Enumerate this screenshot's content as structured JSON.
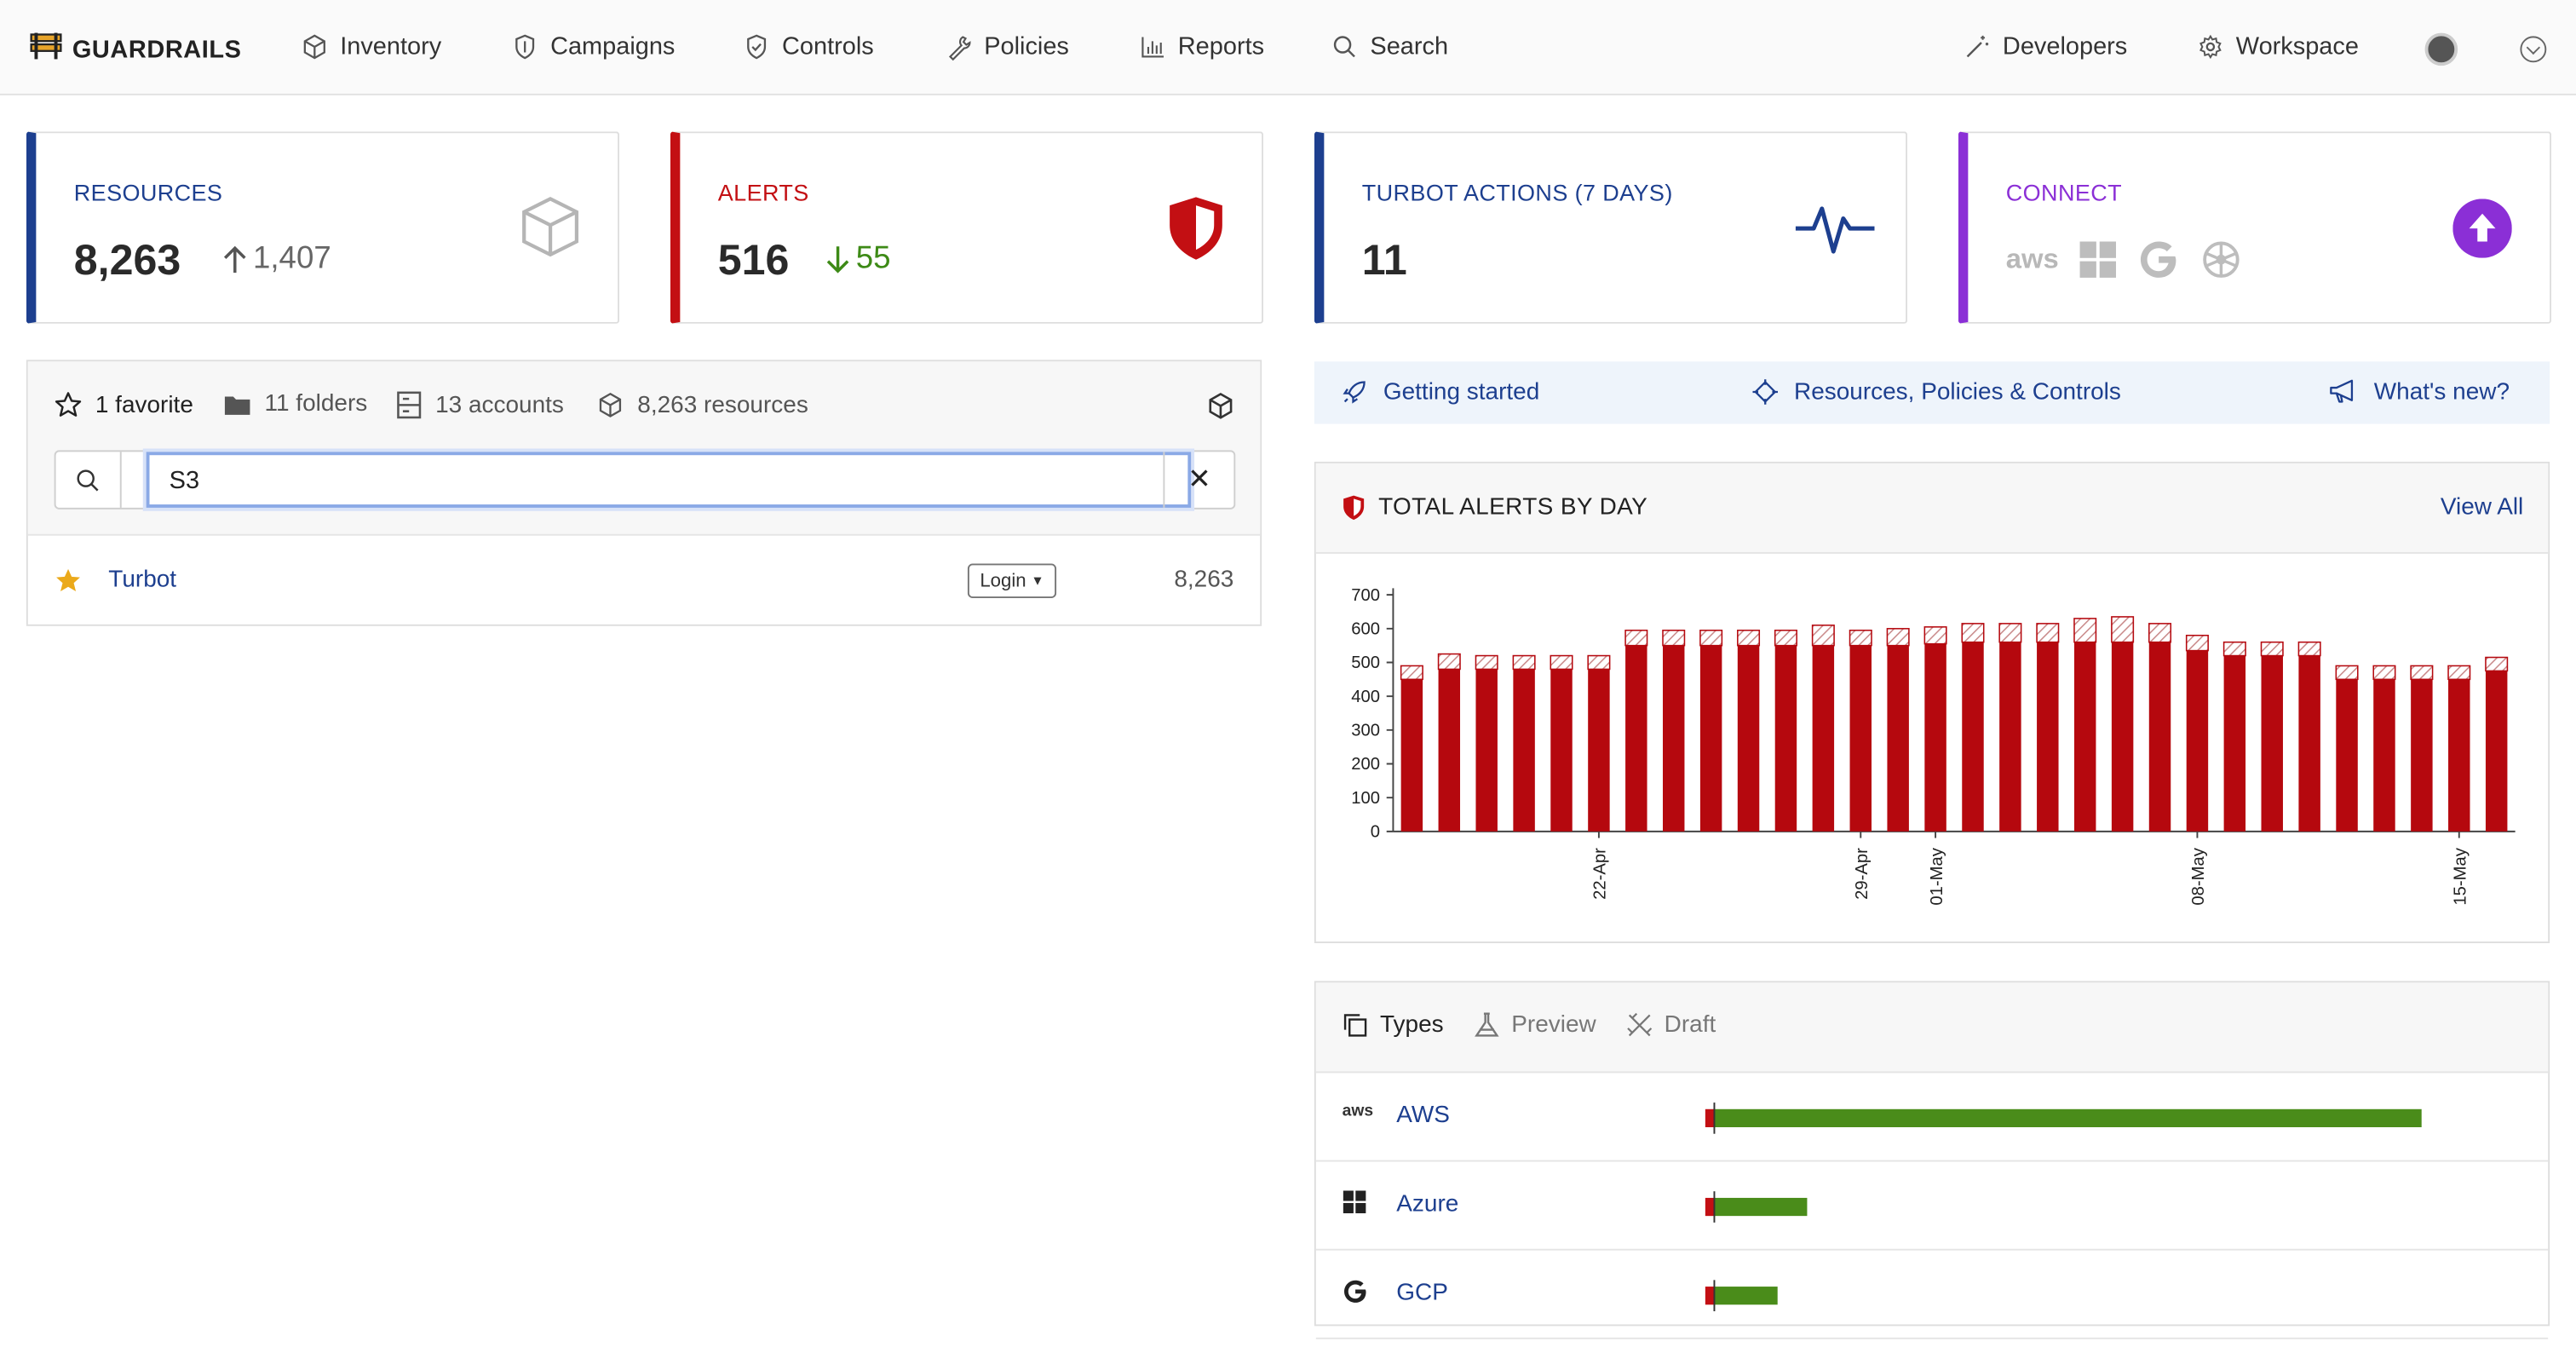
{
  "brand": {
    "name": "GUARDRAILS"
  },
  "nav": {
    "items": [
      {
        "label": "Inventory",
        "icon": "cube-icon"
      },
      {
        "label": "Campaigns",
        "icon": "shield-icon"
      },
      {
        "label": "Controls",
        "icon": "shield-check-icon"
      },
      {
        "label": "Policies",
        "icon": "wrench-icon"
      },
      {
        "label": "Reports",
        "icon": "bar-chart-icon"
      },
      {
        "label": "Search",
        "icon": "search-icon"
      }
    ],
    "right": [
      {
        "label": "Developers",
        "icon": "magic-wand-icon"
      },
      {
        "label": "Workspace",
        "icon": "gear-icon"
      }
    ]
  },
  "stats": {
    "resources": {
      "label": "RESOURCES",
      "value": "8,263",
      "delta": "1,407",
      "accent": "#1d3f8f"
    },
    "alerts": {
      "label": "ALERTS",
      "value": "516",
      "delta": "55",
      "accent": "#c30f13"
    },
    "actions": {
      "label": "TURBOT ACTIONS (7 DAYS)",
      "value": "11",
      "accent": "#1d3f8f"
    },
    "connect": {
      "label": "CONNECT",
      "accent": "#8b2fd6",
      "providers": [
        "aws",
        "azure",
        "google",
        "kubernetes"
      ]
    }
  },
  "favorites": {
    "favorite_count": "1 favorite",
    "folders": "11 folders",
    "accounts": "13 accounts",
    "resources": "8,263 resources",
    "search_value": "S3",
    "rows": [
      {
        "name": "Turbot",
        "login_label": "Login",
        "count": "8,263"
      }
    ]
  },
  "quicklinks": [
    {
      "label": "Getting started",
      "icon": "rocket-icon"
    },
    {
      "label": "Resources, Policies & Controls",
      "icon": "target-icon"
    },
    {
      "label": "What's new?",
      "icon": "megaphone-icon"
    }
  ],
  "alerts_panel": {
    "title": "TOTAL ALERTS BY DAY",
    "link": "View All"
  },
  "chart_data": {
    "type": "bar",
    "ylim": [
      0,
      700
    ],
    "yticks": [
      0,
      100,
      200,
      300,
      400,
      500,
      600,
      700
    ],
    "x_ticks": [
      {
        "index": 5,
        "label": "22-Apr"
      },
      {
        "index": 12,
        "label": "29-Apr"
      },
      {
        "index": 14,
        "label": "01-May"
      },
      {
        "index": 21,
        "label": "08-May"
      },
      {
        "index": 28,
        "label": "15-May"
      }
    ],
    "colors": {
      "primary": "#b5080e",
      "secondary": "#e7b4b4"
    },
    "series": [
      {
        "values": [
          450,
          480,
          480,
          480,
          480,
          480,
          550,
          550,
          550,
          550,
          550,
          550,
          550,
          550,
          555,
          560,
          560,
          560,
          560,
          560,
          560,
          535,
          520,
          520,
          520,
          450,
          450,
          450,
          450,
          475
        ]
      },
      {
        "values": [
          40,
          45,
          40,
          40,
          40,
          40,
          45,
          45,
          45,
          45,
          45,
          60,
          45,
          50,
          50,
          55,
          55,
          55,
          70,
          75,
          55,
          45,
          40,
          40,
          40,
          40,
          40,
          40,
          40,
          40
        ]
      }
    ]
  },
  "types_panel": {
    "tabs": [
      {
        "label": "Types",
        "icon": "copy-icon",
        "active": true
      },
      {
        "label": "Preview",
        "icon": "flask-icon",
        "active": false
      },
      {
        "label": "Draft",
        "icon": "pencil-ruler-icon",
        "active": false
      }
    ],
    "rows": [
      {
        "name": "AWS",
        "icon": "aws-icon",
        "red_fraction": 0.012,
        "green_fraction": 0.98
      },
      {
        "name": "Azure",
        "icon": "azure-icon",
        "red_fraction": 0.012,
        "green_fraction": 0.13
      },
      {
        "name": "GCP",
        "icon": "google-icon",
        "red_fraction": 0.012,
        "green_fraction": 0.087
      }
    ]
  }
}
